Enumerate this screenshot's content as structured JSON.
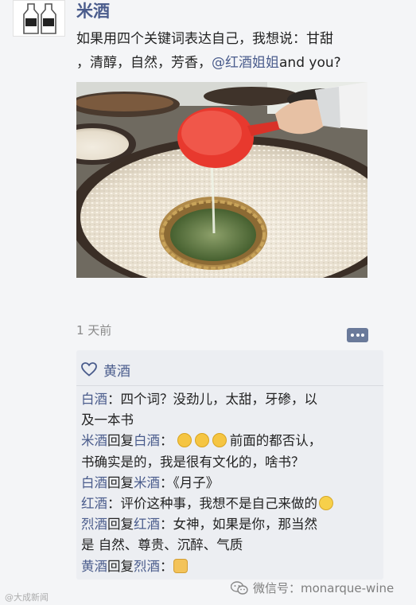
{
  "post": {
    "author": "米酒",
    "text_line1": "如果用四个关键词表达自己，我想说：甘甜",
    "text_line2_prefix": "，清醇，自然，芳香，",
    "mention": "@红酒姐姐",
    "text_line2_suffix": "and you?",
    "time": "1 天前"
  },
  "likes": {
    "icon": "heart-outline-icon",
    "name": "黄酒"
  },
  "comments": [
    {
      "user": "白酒",
      "text": "：四个词？没劲儿，太甜，牙碜，以"
    },
    {
      "text": "及一本书"
    },
    {
      "user": "米酒",
      "reply_word": "回复",
      "reply_to": "白酒",
      "text_after_emoji": "前面的都否认，",
      "emojis": [
        "pray-icon",
        "pray-icon",
        "pray-icon"
      ]
    },
    {
      "text": "书确实是的，我是很有文化的，啥书？"
    },
    {
      "user": "白酒",
      "reply_word": "回复",
      "reply_to": "米酒",
      "text": "：《月子》"
    },
    {
      "user": "红酒",
      "text": "：评价这种事，我想不是自己来做的"
    },
    {
      "user": "烈酒",
      "reply_word": "回复",
      "reply_to": "红酒",
      "text": "：女神，如果是你，那当然"
    },
    {
      "text": "是 自然、尊贵、沉醉、气质"
    },
    {
      "user": "黄酒",
      "reply_word": "回复",
      "reply_to": "烈酒",
      "text": "："
    }
  ],
  "watermarks": {
    "left": "@大成新闻",
    "right": "微信号：monarque-wine"
  },
  "colors": {
    "link_blue": "#4a5c8c",
    "background": "#f4f5f7",
    "comment_bg": "#eceef2"
  }
}
